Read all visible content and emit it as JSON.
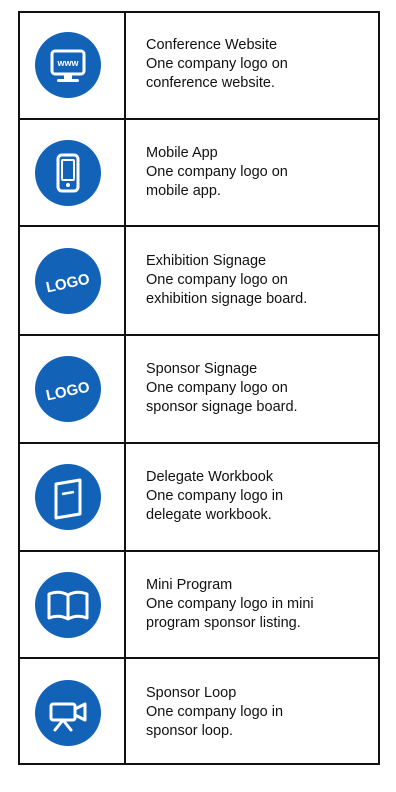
{
  "rows": [
    {
      "title": "Conference Website",
      "desc1": "One company logo on",
      "desc2": "conference website.",
      "icon": "website-icon"
    },
    {
      "title": "Mobile App",
      "desc1": "One company logo on",
      "desc2": "mobile app.",
      "icon": "mobile-phone-icon"
    },
    {
      "title": "Exhibition Signage",
      "desc1": "One company logo on",
      "desc2": "exhibition signage board.",
      "icon": "logo-badge-icon",
      "icon_text": "LOGO"
    },
    {
      "title": "Sponsor Signage",
      "desc1": "One company logo on",
      "desc2": "sponsor signage board.",
      "icon": "logo-badge-icon",
      "icon_text": "LOGO"
    },
    {
      "title": "Delegate Workbook",
      "desc1": "One company logo in",
      "desc2": "delegate workbook.",
      "icon": "workbook-icon"
    },
    {
      "title": "Mini Program",
      "desc1": "One company logo in mini",
      "desc2": "program sponsor listing.",
      "icon": "open-book-icon"
    },
    {
      "title": "Sponsor Loop",
      "desc1": "One company logo in",
      "desc2": "sponsor loop.",
      "icon": "video-camera-icon"
    }
  ],
  "website_icon_text": "www",
  "colors": {
    "icon_bg": "#1263b8",
    "border": "#111111"
  }
}
